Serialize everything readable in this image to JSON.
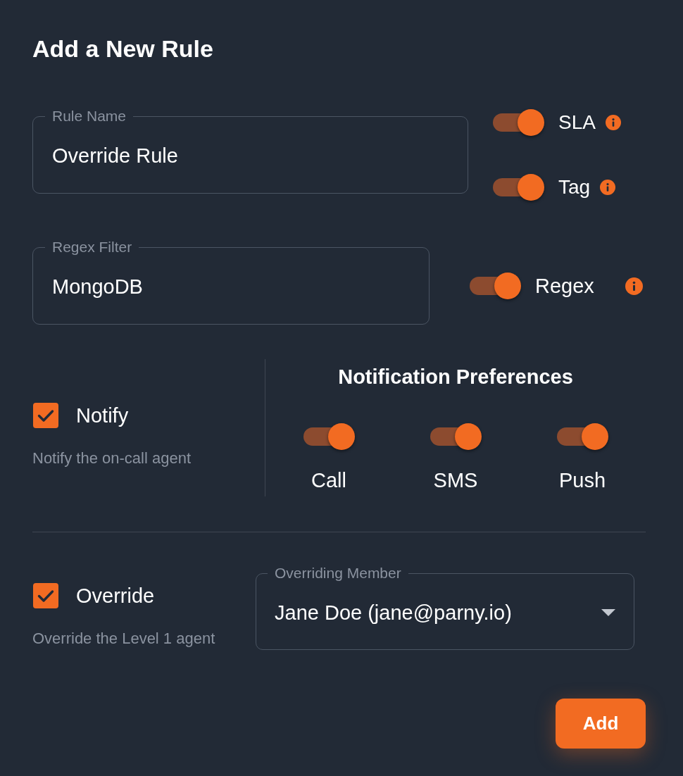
{
  "heading": "Add a New Rule",
  "rule_name_field": {
    "label": "Rule Name",
    "value": "Override Rule"
  },
  "rule_switches": [
    {
      "label": "SLA",
      "on": true
    },
    {
      "label": "Tag",
      "on": true
    }
  ],
  "regex_filter_field": {
    "label": "Regex Filter",
    "value": "MongoDB"
  },
  "regex_switch": {
    "label": "Regex",
    "on": true
  },
  "notify": {
    "label": "Notify",
    "checked": true,
    "description": "Notify the on-call agent"
  },
  "notification_preferences": {
    "title": "Notification Preferences",
    "channels": [
      {
        "label": "Call",
        "on": true
      },
      {
        "label": "SMS",
        "on": true
      },
      {
        "label": "Push",
        "on": true
      }
    ]
  },
  "override": {
    "label": "Override",
    "checked": true,
    "description": "Override the Level 1 agent"
  },
  "overriding_member_select": {
    "label": "Overriding Member",
    "value": "Jane Doe (jane@parny.io)"
  },
  "add_button": {
    "label": "Add"
  }
}
